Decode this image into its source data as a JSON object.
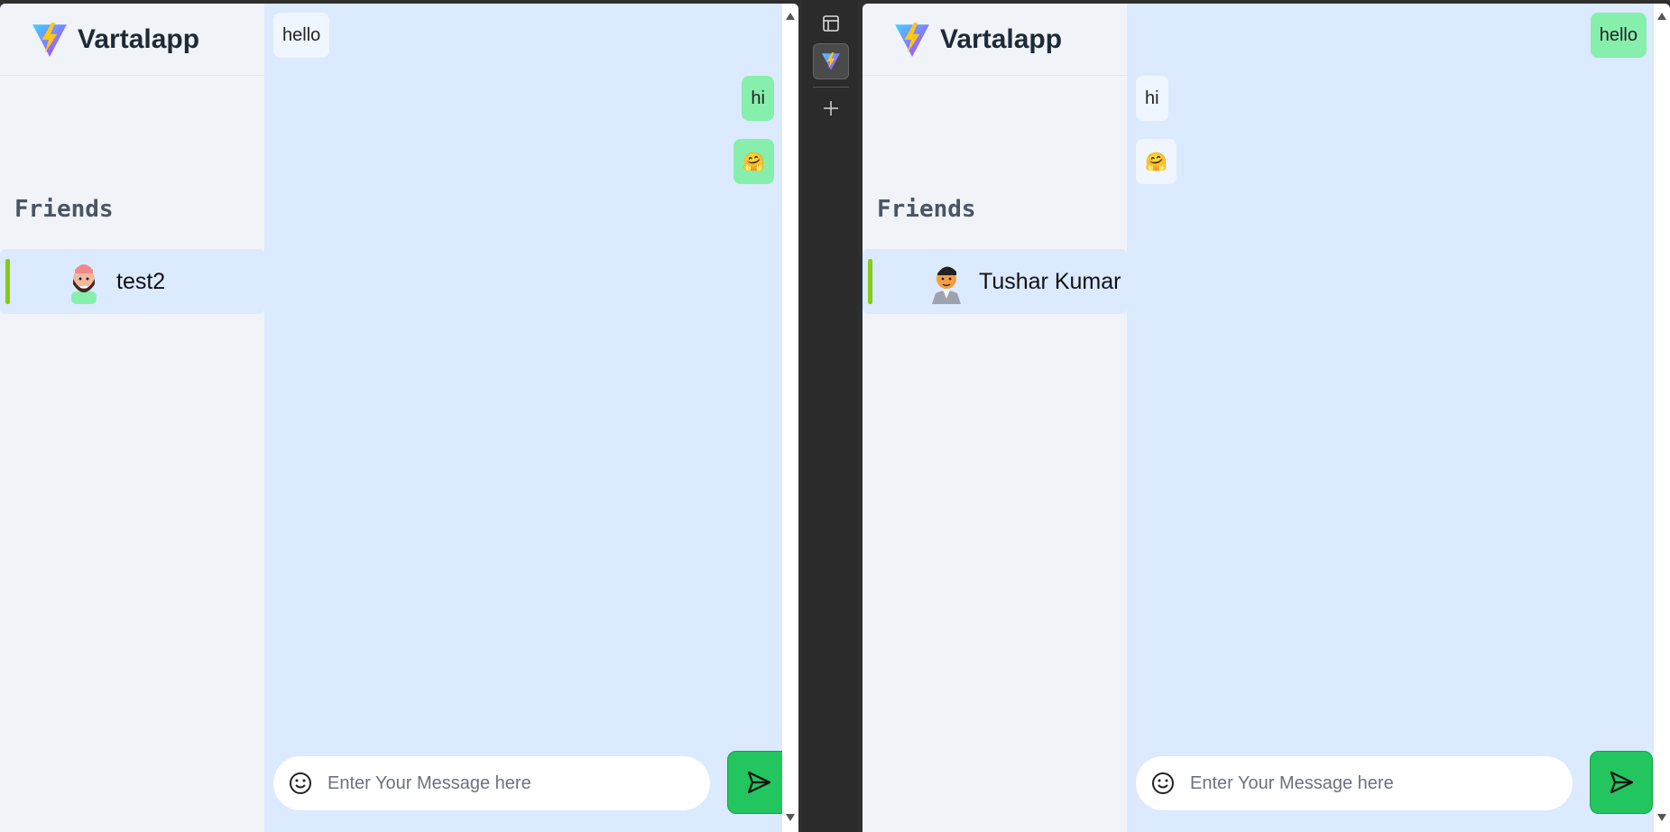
{
  "app": {
    "name": "Vartalapp"
  },
  "left_pane": {
    "friends_title": "Friends",
    "friend": {
      "name": "test2"
    },
    "messages": [
      {
        "text": "hello",
        "direction": "received"
      },
      {
        "text": "hi",
        "direction": "sent"
      },
      {
        "text": "🤗",
        "direction": "sent"
      }
    ],
    "composer": {
      "placeholder": "Enter Your Message here",
      "value": ""
    }
  },
  "right_pane": {
    "friends_title": "Friends",
    "friend": {
      "name": "Tushar Kumar"
    },
    "messages": [
      {
        "text": "hello",
        "direction": "sent"
      },
      {
        "text": "hi",
        "direction": "received"
      },
      {
        "text": "🤗",
        "direction": "received"
      }
    ],
    "composer": {
      "placeholder": "Enter Your Message here",
      "value": ""
    }
  },
  "icons": {
    "logo": "vite-lightning-logo",
    "emoji": "smile-icon",
    "send": "send-icon",
    "sidebar_toggle": "sidebar-toggle-icon",
    "new_tab": "plus-icon"
  },
  "colors": {
    "chat_bg": "#dbeafe",
    "sidebar_bg": "#f0f4f8",
    "sent_bubble": "#86efac",
    "received_bubble": "#eff6ff",
    "send_button": "#22c55e",
    "online_accent": "#84cc16"
  }
}
